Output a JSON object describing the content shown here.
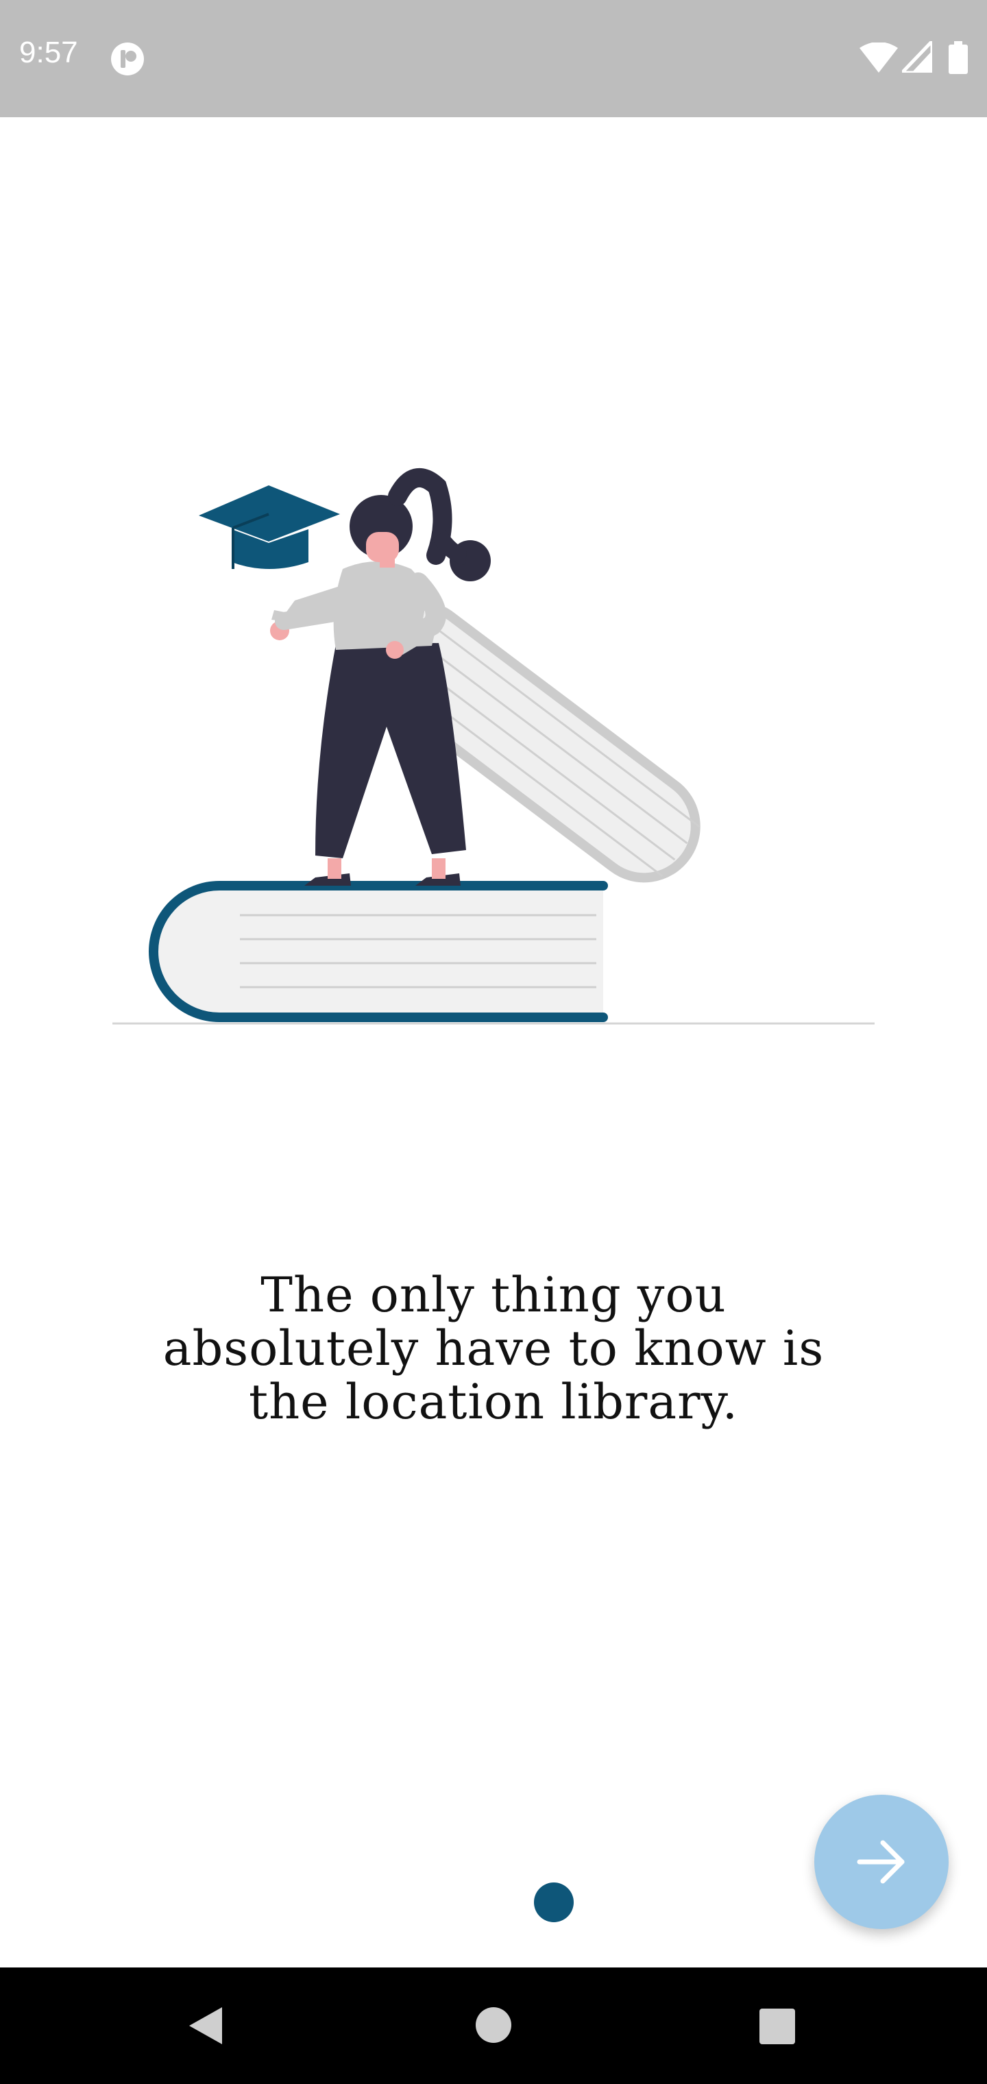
{
  "status_bar": {
    "time": "9:57",
    "icons": [
      "app-notification-icon",
      "wifi-icon",
      "signal-icon",
      "battery-icon"
    ]
  },
  "onboarding": {
    "illustration": "woman-on-books-graduation-illustration",
    "message_lines": [
      "The only thing you",
      "absolutely have to know is",
      "the location library."
    ],
    "page_indicator": {
      "current": 1,
      "total": 1
    },
    "next_button": {
      "icon": "arrow-right-icon"
    }
  },
  "nav_bar": {
    "icons": [
      "back-icon",
      "home-icon",
      "recents-icon"
    ]
  },
  "colors": {
    "status_bar": "#bdbdbd",
    "accent": "#0e5679",
    "fab": "#9ec9e8",
    "nav_bar": "#000000"
  }
}
